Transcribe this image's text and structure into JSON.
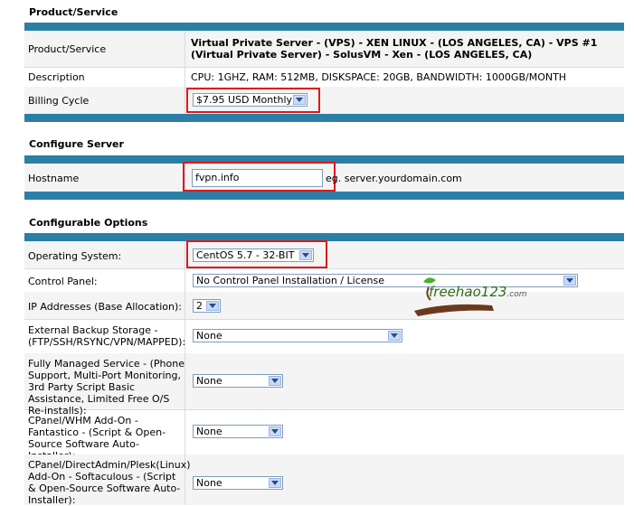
{
  "sections": {
    "product": "Product/Service",
    "configure": "Configure Server",
    "options": "Configurable Options"
  },
  "product": {
    "rows": [
      {
        "label": "Product/Service",
        "value": "Virtual Private Server - (VPS) - XEN LINUX - (LOS ANGELES, CA) - VPS #1 (Virtual Private Server) - SolusVM - Xen - (LOS ANGELES, CA)"
      },
      {
        "label": "Description",
        "value": "CPU: 1GHZ, RAM: 512MB, DISKSPACE: 20GB, BANDWIDTH: 1000GB/MONTH"
      },
      {
        "label": "Billing Cycle",
        "value": "$7.95 USD Monthly"
      }
    ]
  },
  "configure": {
    "hostname_label": "Hostname",
    "hostname_value": "fvpn.info",
    "hostname_hint": "eg. server.yourdomain.com"
  },
  "options": {
    "rows": [
      {
        "label": "Operating System:",
        "value": "CentOS 5.7 - 32-BIT"
      },
      {
        "label": "Control Panel:",
        "value": "No Control Panel Installation / License"
      },
      {
        "label": "IP Addresses (Base Allocation):",
        "value": "2"
      },
      {
        "label": "External Backup Storage - (FTP/SSH/RSYNC/VPN/MAPPED):",
        "value": "None"
      },
      {
        "label": "Fully Managed Service - (Phone Support, Multi-Port Monitoring, 3rd Party Script Basic Assistance, Limited Free O/S Re-installs):",
        "value": "None"
      },
      {
        "label": "CPanel/WHM Add-On - Fantastico - (Script & Open-Source Software Auto-Installer):",
        "value": "None"
      },
      {
        "label": "CPanel/DirectAdmin/Plesk(Linux) Add-On - Softaculous - (Script & Open-Source Software Auto-Installer):",
        "value": "None"
      }
    ]
  },
  "watermark": {
    "text": "freehao123",
    "suffix": ".com"
  },
  "colors": {
    "bar": "#2b7fa6",
    "highlight": "#e01818",
    "row_alt": "#f4f4f4"
  }
}
